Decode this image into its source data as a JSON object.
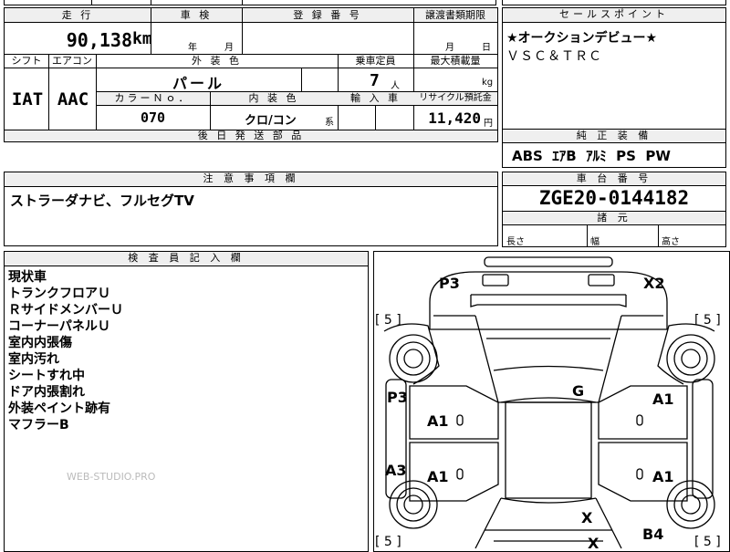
{
  "top_strip": {
    "partial_text": "四 万 开"
  },
  "main": {
    "labels": {
      "mileage": "走 行",
      "inspection": "車 検",
      "registration": "登 録 番 号",
      "transfer_deadline": "譲渡書類期限",
      "shift": "シフト",
      "aircon": "エアコン",
      "exterior_color": "外 装 色",
      "capacity": "乗車定員",
      "max_load": "最大積載量",
      "color_no": "カラーＮｏ．",
      "interior_color": "内 装 色",
      "import": "輸 入 車",
      "recycle": "リサイクル預託金",
      "later_parts": "後 日 発 送 部 品"
    },
    "mileage_value": "90,138",
    "mileage_unit": "km",
    "year_unit": "年",
    "month_unit": "月",
    "deadline_month": "月",
    "deadline_day": "日",
    "shift_value": "IAT",
    "aircon_value": "AAC",
    "exterior_color_value": "パール",
    "capacity_value": "7",
    "capacity_unit": "人",
    "max_load_unit": "kg",
    "color_no_value": "070",
    "interior_color_value": "クロ/コン",
    "interior_suffix": "系",
    "recycle_value": "11,420",
    "recycle_unit": "円"
  },
  "sales_points": {
    "header": "セールスポイント",
    "lines": [
      "★オークションデビュー★",
      "ＶＳＣ＆ＴＲＣ"
    ]
  },
  "equipment": {
    "header": "純 正 装 備",
    "value": "ABS  ｴｱB  ｱﾙﾐ  PS  PW"
  },
  "notes": {
    "header": "注 意 事 項 欄",
    "value": "ストラーダナビ、フルセグTV"
  },
  "chassis": {
    "header": "車 台 番 号",
    "value": "ZGE20-0144182"
  },
  "dimensions": {
    "header": "諸 元",
    "length": "長さ",
    "width": "幅",
    "height": "高さ"
  },
  "inspector": {
    "header": "検 査 員 記 入 欄",
    "lines": [
      "現状車",
      "トランクフロアＵ",
      "ＲサイドメンバーＵ",
      "コーナーパネルＵ",
      "室内内張傷",
      "室内汚れ",
      "シートすれ中",
      "ドア内張割れ",
      "外装ペイント跡有",
      "マフラーB"
    ],
    "watermark": "WEB-STUDIO.PRO"
  },
  "diagram": {
    "marks": {
      "p3_top": "P3",
      "x2": "X2",
      "p3_left": "P3",
      "a3": "A3",
      "g": "G",
      "a1_left_front": "A1",
      "a1_right_front": "A1",
      "a1_left_rear": "A1",
      "a1_right_rear": "A1",
      "x_bottom": "X",
      "x_bottom2": "X",
      "b4": "B4"
    },
    "tires": {
      "front_left": "[ 5 ]",
      "front_right": "[ 5 ]",
      "rear_left": "[ 5 ]",
      "rear_right": "[ 5 ]"
    }
  }
}
